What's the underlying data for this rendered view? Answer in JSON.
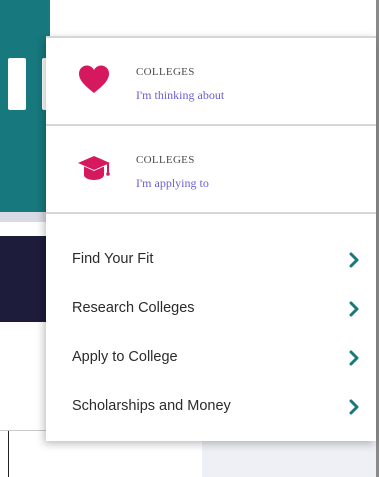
{
  "lists": [
    {
      "eyebrow": "COLLEGES",
      "title": "I'm thinking about",
      "icon": "heart-icon",
      "icon_color": "#d6185e"
    },
    {
      "eyebrow": "COLLEGES",
      "title": "I'm applying to",
      "icon": "graduation-cap-icon",
      "icon_color": "#d6185e"
    }
  ],
  "nav": [
    {
      "label": "Find Your Fit",
      "icon": "chevron-right-icon"
    },
    {
      "label": "Research Colleges",
      "icon": "chevron-right-icon"
    },
    {
      "label": "Apply to College",
      "icon": "chevron-right-icon"
    },
    {
      "label": "Scholarships and Money",
      "icon": "chevron-right-icon"
    }
  ],
  "colors": {
    "accent": "#d6185e",
    "link": "#6a5fd0",
    "chevron": "#17787d",
    "teal_bg": "#17787d",
    "navy_bg": "#1d1c3a"
  }
}
